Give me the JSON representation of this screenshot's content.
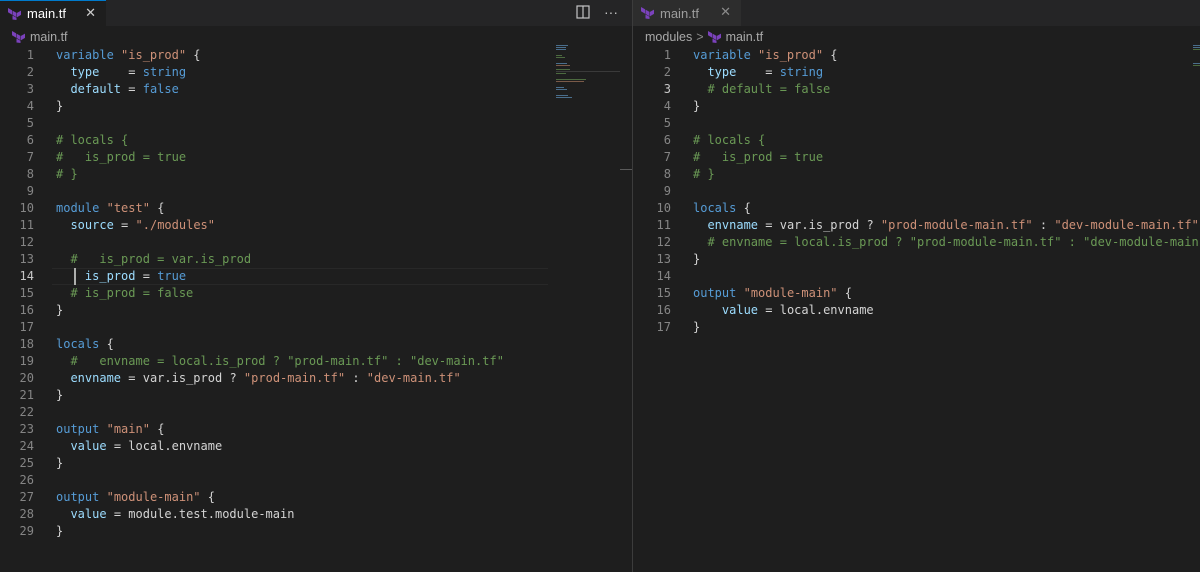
{
  "left_pane": {
    "tab": {
      "title": "main.tf",
      "close": "✕"
    },
    "actions": {
      "split": "split-editor",
      "more": "···"
    },
    "breadcrumb": {
      "file": "main.tf"
    },
    "lines": [
      {
        "n": "1",
        "text": "variable \"is_prod\" {"
      },
      {
        "n": "2",
        "text": "  type    = string"
      },
      {
        "n": "3",
        "text": "  default = false"
      },
      {
        "n": "4",
        "text": "}"
      },
      {
        "n": "5",
        "text": ""
      },
      {
        "n": "6",
        "text": "# locals {"
      },
      {
        "n": "7",
        "text": "#   is_prod = true"
      },
      {
        "n": "8",
        "text": "# }"
      },
      {
        "n": "9",
        "text": ""
      },
      {
        "n": "10",
        "text": "module \"test\" {"
      },
      {
        "n": "11",
        "text": "  source = \"./modules\""
      },
      {
        "n": "12",
        "text": ""
      },
      {
        "n": "13",
        "text": "  #   is_prod = var.is_prod"
      },
      {
        "n": "14",
        "text": "    is_prod = true"
      },
      {
        "n": "15",
        "text": "  # is_prod = false"
      },
      {
        "n": "16",
        "text": "}"
      },
      {
        "n": "17",
        "text": ""
      },
      {
        "n": "18",
        "text": "locals {"
      },
      {
        "n": "19",
        "text": "  #   envname = local.is_prod ? \"prod-main.tf\" : \"dev-main.tf\""
      },
      {
        "n": "20",
        "text": "  envname = var.is_prod ? \"prod-main.tf\" : \"dev-main.tf\""
      },
      {
        "n": "21",
        "text": "}"
      },
      {
        "n": "22",
        "text": ""
      },
      {
        "n": "23",
        "text": "output \"main\" {"
      },
      {
        "n": "24",
        "text": "  value = local.envname"
      },
      {
        "n": "25",
        "text": "}"
      },
      {
        "n": "26",
        "text": ""
      },
      {
        "n": "27",
        "text": "output \"module-main\" {"
      },
      {
        "n": "28",
        "text": "  value = module.test.module-main"
      },
      {
        "n": "29",
        "text": "}"
      }
    ]
  },
  "right_pane": {
    "tab": {
      "title": "main.tf",
      "close": "✕"
    },
    "breadcrumb": {
      "folder": "modules",
      "separator": ">",
      "file": "main.tf"
    },
    "lines": [
      {
        "n": "1",
        "text": "variable \"is_prod\" {"
      },
      {
        "n": "2",
        "text": "  type    = string"
      },
      {
        "n": "3",
        "text": "  # default = false"
      },
      {
        "n": "4",
        "text": "}"
      },
      {
        "n": "5",
        "text": ""
      },
      {
        "n": "6",
        "text": "# locals {"
      },
      {
        "n": "7",
        "text": "#   is_prod = true"
      },
      {
        "n": "8",
        "text": "# }"
      },
      {
        "n": "9",
        "text": ""
      },
      {
        "n": "10",
        "text": "locals {"
      },
      {
        "n": "11",
        "text": "  envname = var.is_prod ? \"prod-module-main.tf\" : \"dev-module-main.tf\""
      },
      {
        "n": "12",
        "text": "  # envname = local.is_prod ? \"prod-module-main.tf\" : \"dev-module-main.tf\""
      },
      {
        "n": "13",
        "text": "}"
      },
      {
        "n": "14",
        "text": ""
      },
      {
        "n": "15",
        "text": "output \"module-main\" {"
      },
      {
        "n": "16",
        "text": "    value = local.envname"
      },
      {
        "n": "17",
        "text": "}"
      }
    ]
  },
  "cursor_line": {
    "left": "14",
    "right": "3"
  },
  "colors": {
    "keyword": "#569cd6",
    "string": "#ce9178",
    "comment": "#6a9955",
    "identifier": "#9cdcfe",
    "text": "#d4d4d4",
    "terraform_icon": "#7b42bc"
  }
}
